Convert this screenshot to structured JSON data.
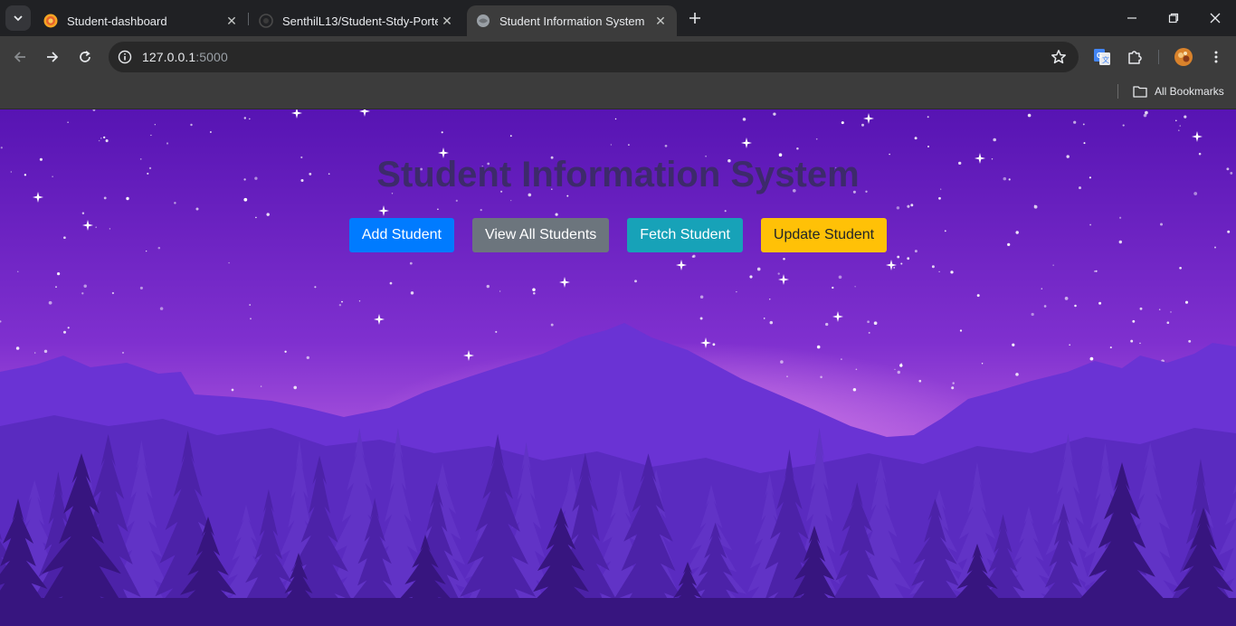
{
  "browser": {
    "tabs": [
      {
        "title": "Student-dashboard",
        "active": false
      },
      {
        "title": "SenthilL13/Student-Stdy-Portel",
        "active": false
      },
      {
        "title": "Student Information System",
        "active": true
      }
    ],
    "url_host": "127.0.0.1",
    "url_port": ":5000",
    "bookmarks_label": "All Bookmarks"
  },
  "page": {
    "title": "Student Information System",
    "buttons": {
      "add": "Add Student",
      "view_all": "View All Students",
      "fetch": "Fetch Student",
      "update": "Update Student"
    }
  },
  "colors": {
    "primary": "#007bff",
    "secondary": "#6c757d",
    "info": "#17a2b8",
    "warning": "#ffc107",
    "sky_top": "#5a16b6",
    "sky_bottom": "#c26ae0"
  }
}
